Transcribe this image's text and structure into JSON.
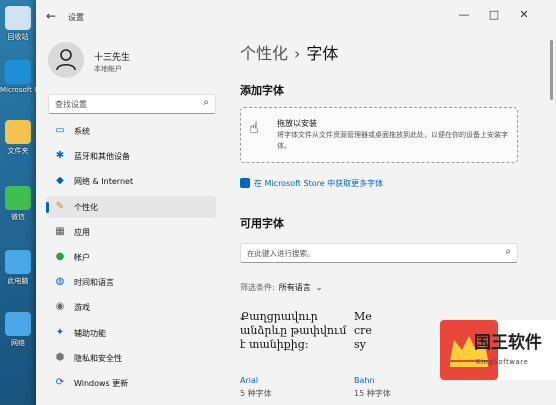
{
  "desktop": {
    "icons": [
      {
        "label": "回收站",
        "color": "#cfe3f3"
      },
      {
        "label": "Microsoft Edge",
        "color": "#1e8fd6"
      },
      {
        "label": "文件夹",
        "color": "#f3c34d"
      },
      {
        "label": "微信",
        "color": "#3fbf4f"
      },
      {
        "label": "此电脑",
        "color": "#4aa8e8"
      },
      {
        "label": "网络",
        "color": "#4aa8e8"
      }
    ]
  },
  "window": {
    "title": "设置",
    "back_icon": "arrow-left-icon",
    "controls": {
      "minimize": "—",
      "maximize": "□",
      "close": "✕"
    }
  },
  "user": {
    "name": "十三先生",
    "account_type": "本地帐户"
  },
  "search": {
    "placeholder": "查找设置",
    "icon": "search-icon"
  },
  "nav": [
    {
      "label": "系统",
      "icon": "monitor-icon",
      "glyph": "▭",
      "color": "#0067c0"
    },
    {
      "label": "蓝牙和其他设备",
      "icon": "bluetooth-icon",
      "glyph": "✱",
      "color": "#0067c0"
    },
    {
      "label": "网络 & Internet",
      "icon": "wifi-icon",
      "glyph": "◆",
      "color": "#0a5ea8"
    },
    {
      "label": "个性化",
      "icon": "brush-icon",
      "glyph": "✎",
      "color": "#d87b2a",
      "active": true
    },
    {
      "label": "应用",
      "icon": "apps-icon",
      "glyph": "▦",
      "color": "#555"
    },
    {
      "label": "帐户",
      "icon": "account-icon",
      "glyph": "●",
      "color": "#2b9f4a"
    },
    {
      "label": "时间和语言",
      "icon": "globe-clock-icon",
      "glyph": "◍",
      "color": "#0067c0"
    },
    {
      "label": "游戏",
      "icon": "gamepad-icon",
      "glyph": "◉",
      "color": "#666"
    },
    {
      "label": "辅助功能",
      "icon": "accessibility-icon",
      "glyph": "✦",
      "color": "#0067c0"
    },
    {
      "label": "隐私和安全性",
      "icon": "shield-icon",
      "glyph": "⬢",
      "color": "#777"
    },
    {
      "label": "Windows 更新",
      "icon": "update-icon",
      "glyph": "⟳",
      "color": "#0067c0"
    }
  ],
  "breadcrumb": {
    "parent": "个性化",
    "separator": "›",
    "current": "字体"
  },
  "add_fonts": {
    "heading": "添加字体",
    "drop_title": "拖放以安装",
    "drop_desc": "将字体文件从文件资源管理器或桌面拖放到此处，以便在你的设备上安装字体。",
    "store_link": "在 Microsoft Store 中获取更多字体"
  },
  "available_fonts": {
    "heading": "可用字体",
    "search_placeholder": "在此键入进行搜索。",
    "filter_label": "筛选条件:",
    "filter_value": "所有语言",
    "cards": [
      {
        "sample": "Քաղցրավուր անձրևը թափվում է տանիքից:",
        "name": "Arial",
        "count": "5 种字体"
      },
      {
        "sample": "Me cre sy",
        "name": "Bahn",
        "count": "15 种字体"
      }
    ]
  },
  "watermark": {
    "title": "国王软件",
    "subtitle": "KingSoftware"
  }
}
